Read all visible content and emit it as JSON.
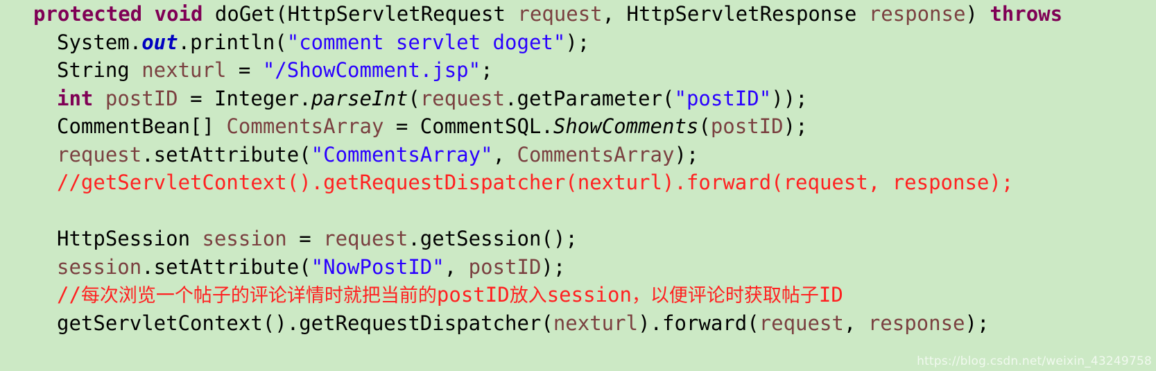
{
  "editor": {
    "background_color": "#cce9c5",
    "language": "java",
    "theme_colors": {
      "keyword": "#7f0055",
      "string": "#2a00ff",
      "comment": "#ff2020",
      "variable": "#7a4040",
      "static_field": "#0000c0",
      "plain": "#000000"
    }
  },
  "watermark": {
    "text": "https://blog.csdn.net/weixin_43249758"
  },
  "code": {
    "lines": [
      {
        "index": 0,
        "indent": 0,
        "text": "protected void doGet(HttpServletRequest request, HttpServletResponse response) throws",
        "tokens": [
          {
            "t": "protected",
            "c": "keyword"
          },
          {
            "t": " ",
            "c": "plain"
          },
          {
            "t": "void",
            "c": "keyword"
          },
          {
            "t": " doGet(HttpServletRequest ",
            "c": "plain"
          },
          {
            "t": "request",
            "c": "var"
          },
          {
            "t": ", HttpServletResponse ",
            "c": "plain"
          },
          {
            "t": "response",
            "c": "var"
          },
          {
            "t": ") ",
            "c": "plain"
          },
          {
            "t": "throws",
            "c": "keyword"
          }
        ]
      },
      {
        "index": 1,
        "indent": 1,
        "text": "System.out.println(\"comment servlet doget\");",
        "tokens": [
          {
            "t": "System.",
            "c": "plain"
          },
          {
            "t": "out",
            "c": "field"
          },
          {
            "t": ".println(",
            "c": "plain"
          },
          {
            "t": "\"comment servlet doget\"",
            "c": "string"
          },
          {
            "t": ");",
            "c": "plain"
          }
        ]
      },
      {
        "index": 2,
        "indent": 1,
        "text": "String nexturl = \"/ShowComment.jsp\";",
        "tokens": [
          {
            "t": "String ",
            "c": "plain"
          },
          {
            "t": "nexturl",
            "c": "var"
          },
          {
            "t": " = ",
            "c": "plain"
          },
          {
            "t": "\"/ShowComment.jsp\"",
            "c": "string"
          },
          {
            "t": ";",
            "c": "plain"
          }
        ]
      },
      {
        "index": 3,
        "indent": 1,
        "text": "int postID = Integer.parseInt(request.getParameter(\"postID\"));",
        "tokens": [
          {
            "t": "int",
            "c": "keyword"
          },
          {
            "t": " ",
            "c": "plain"
          },
          {
            "t": "postID",
            "c": "var"
          },
          {
            "t": " = Integer.",
            "c": "plain"
          },
          {
            "t": "parseInt",
            "c": "static"
          },
          {
            "t": "(",
            "c": "plain"
          },
          {
            "t": "request",
            "c": "var"
          },
          {
            "t": ".getParameter(",
            "c": "plain"
          },
          {
            "t": "\"postID\"",
            "c": "string"
          },
          {
            "t": "));",
            "c": "plain"
          }
        ]
      },
      {
        "index": 4,
        "indent": 1,
        "text": "CommentBean[] CommentsArray = CommentSQL.ShowComments(postID);",
        "tokens": [
          {
            "t": "CommentBean[] ",
            "c": "plain"
          },
          {
            "t": "CommentsArray",
            "c": "var"
          },
          {
            "t": " = CommentSQL.",
            "c": "plain"
          },
          {
            "t": "ShowComments",
            "c": "static"
          },
          {
            "t": "(",
            "c": "plain"
          },
          {
            "t": "postID",
            "c": "var"
          },
          {
            "t": ");",
            "c": "plain"
          }
        ]
      },
      {
        "index": 5,
        "indent": 1,
        "text": "request.setAttribute(\"CommentsArray\", CommentsArray);",
        "tokens": [
          {
            "t": "request",
            "c": "var"
          },
          {
            "t": ".setAttribute(",
            "c": "plain"
          },
          {
            "t": "\"CommentsArray\"",
            "c": "string"
          },
          {
            "t": ", ",
            "c": "plain"
          },
          {
            "t": "CommentsArray",
            "c": "var"
          },
          {
            "t": ");",
            "c": "plain"
          }
        ]
      },
      {
        "index": 6,
        "indent": 1,
        "text": "//getServletContext().getRequestDispatcher(nexturl).forward(request, response);",
        "tokens": [
          {
            "t": "//getServletContext().getRequestDispatcher(nexturl).forward(request, response);",
            "c": "comment"
          }
        ]
      },
      {
        "index": 7,
        "indent": 0,
        "text": "",
        "tokens": []
      },
      {
        "index": 8,
        "indent": 1,
        "text": "HttpSession session = request.getSession();",
        "tokens": [
          {
            "t": "HttpSession ",
            "c": "plain"
          },
          {
            "t": "session",
            "c": "var"
          },
          {
            "t": " = ",
            "c": "plain"
          },
          {
            "t": "request",
            "c": "var"
          },
          {
            "t": ".getSession();",
            "c": "plain"
          }
        ]
      },
      {
        "index": 9,
        "indent": 1,
        "text": "session.setAttribute(\"NowPostID\", postID);",
        "tokens": [
          {
            "t": "session",
            "c": "var"
          },
          {
            "t": ".setAttribute(",
            "c": "plain"
          },
          {
            "t": "\"NowPostID\"",
            "c": "string"
          },
          {
            "t": ", ",
            "c": "plain"
          },
          {
            "t": "postID",
            "c": "var"
          },
          {
            "t": ");",
            "c": "plain"
          }
        ]
      },
      {
        "index": 10,
        "indent": 1,
        "text": "//每次浏览一个帖子的评论详情时就把当前的postID放入session，以便评论时获取帖子ID",
        "tokens": [
          {
            "t": "//",
            "c": "comment"
          },
          {
            "t": "每次浏览一个帖子的评论详情时就把当前的",
            "c": "comment-cjk"
          },
          {
            "t": "postID",
            "c": "comment"
          },
          {
            "t": "放入",
            "c": "comment-cjk"
          },
          {
            "t": "session",
            "c": "comment"
          },
          {
            "t": "，",
            "c": "comment-cjk"
          },
          {
            "t": "以便评论时获取帖子",
            "c": "comment-cjk"
          },
          {
            "t": "ID",
            "c": "comment"
          }
        ]
      },
      {
        "index": 11,
        "indent": 1,
        "text": "getServletContext().getRequestDispatcher(nexturl).forward(request, response);",
        "tokens": [
          {
            "t": "getServletContext().getRequestDispatcher(",
            "c": "plain"
          },
          {
            "t": "nexturl",
            "c": "var"
          },
          {
            "t": ").forward(",
            "c": "plain"
          },
          {
            "t": "request",
            "c": "var"
          },
          {
            "t": ", ",
            "c": "plain"
          },
          {
            "t": "response",
            "c": "var"
          },
          {
            "t": ");",
            "c": "plain"
          }
        ]
      }
    ]
  }
}
